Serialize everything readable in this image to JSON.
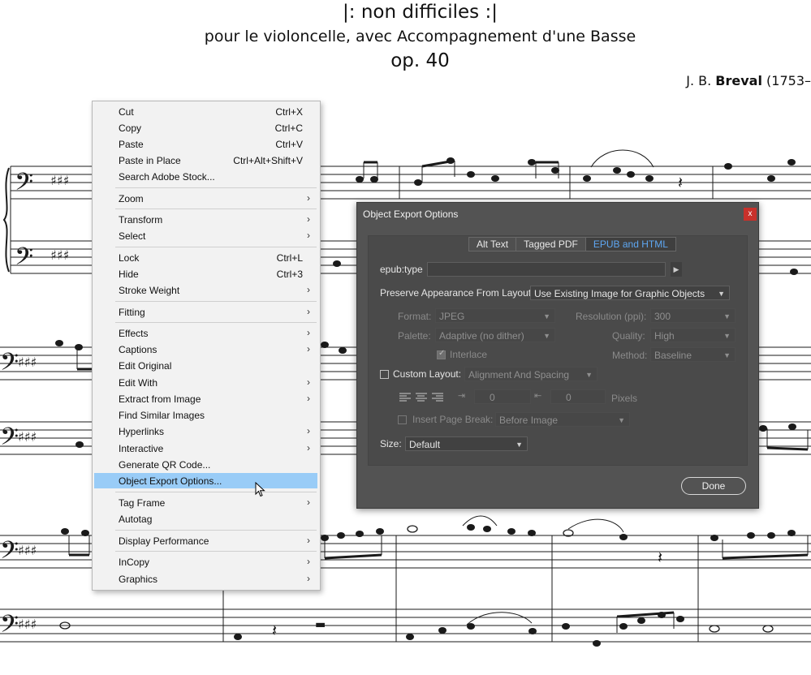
{
  "document": {
    "title": "|: non difficiles :|",
    "subtitle": "pour le violoncelle, avec Accompagnement d'une Basse",
    "opus": "op. 40",
    "composer_initial": "J. B.",
    "composer_name": "Breval",
    "composer_dates": "(1753–"
  },
  "context_menu": {
    "items": [
      {
        "label": "Cut",
        "shortcut": "Ctrl+X"
      },
      {
        "label": "Copy",
        "shortcut": "Ctrl+C"
      },
      {
        "label": "Paste",
        "shortcut": "Ctrl+V"
      },
      {
        "label": "Paste in Place",
        "shortcut": "Ctrl+Alt+Shift+V"
      },
      {
        "label": "Search Adobe Stock..."
      },
      {
        "label": "Zoom"
      },
      {
        "label": "Transform"
      },
      {
        "label": "Select"
      },
      {
        "label": "Lock",
        "shortcut": "Ctrl+L"
      },
      {
        "label": "Hide",
        "shortcut": "Ctrl+3"
      },
      {
        "label": "Stroke Weight"
      },
      {
        "label": "Fitting"
      },
      {
        "label": "Effects"
      },
      {
        "label": "Captions"
      },
      {
        "label": "Edit Original"
      },
      {
        "label": "Edit With"
      },
      {
        "label": "Extract from Image"
      },
      {
        "label": "Find Similar Images"
      },
      {
        "label": "Hyperlinks"
      },
      {
        "label": "Interactive"
      },
      {
        "label": "Generate QR Code..."
      },
      {
        "label": "Object Export Options..."
      },
      {
        "label": "Tag Frame"
      },
      {
        "label": "Autotag"
      },
      {
        "label": "Display Performance"
      },
      {
        "label": "InCopy"
      },
      {
        "label": "Graphics"
      }
    ]
  },
  "dialog": {
    "title": "Object Export Options",
    "close_glyph": "x",
    "tabs": [
      {
        "label": "Alt Text"
      },
      {
        "label": "Tagged PDF"
      },
      {
        "label": "EPUB and HTML",
        "active": true
      }
    ],
    "epub_type_label": "epub:type",
    "epub_type_value": "",
    "preserve_label": "Preserve Appearance From Layout:",
    "preserve_value": "Use Existing Image for Graphic Objects",
    "format_label": "Format:",
    "format_value": "JPEG",
    "resolution_label": "Resolution (ppi):",
    "resolution_value": "300",
    "palette_label": "Palette:",
    "palette_value": "Adaptive (no dither)",
    "quality_label": "Quality:",
    "quality_value": "High",
    "interlace_label": "Interlace",
    "method_label": "Method:",
    "method_value": "Baseline",
    "custom_layout_label": "Custom Layout:",
    "custom_layout_value": "Alignment And Spacing",
    "space_before_value": "0",
    "space_after_value": "0",
    "pixels_label": "Pixels",
    "page_break_label": "Insert Page Break:",
    "page_break_value": "Before Image",
    "size_label": "Size:",
    "size_value": "Default",
    "done_label": "Done"
  }
}
